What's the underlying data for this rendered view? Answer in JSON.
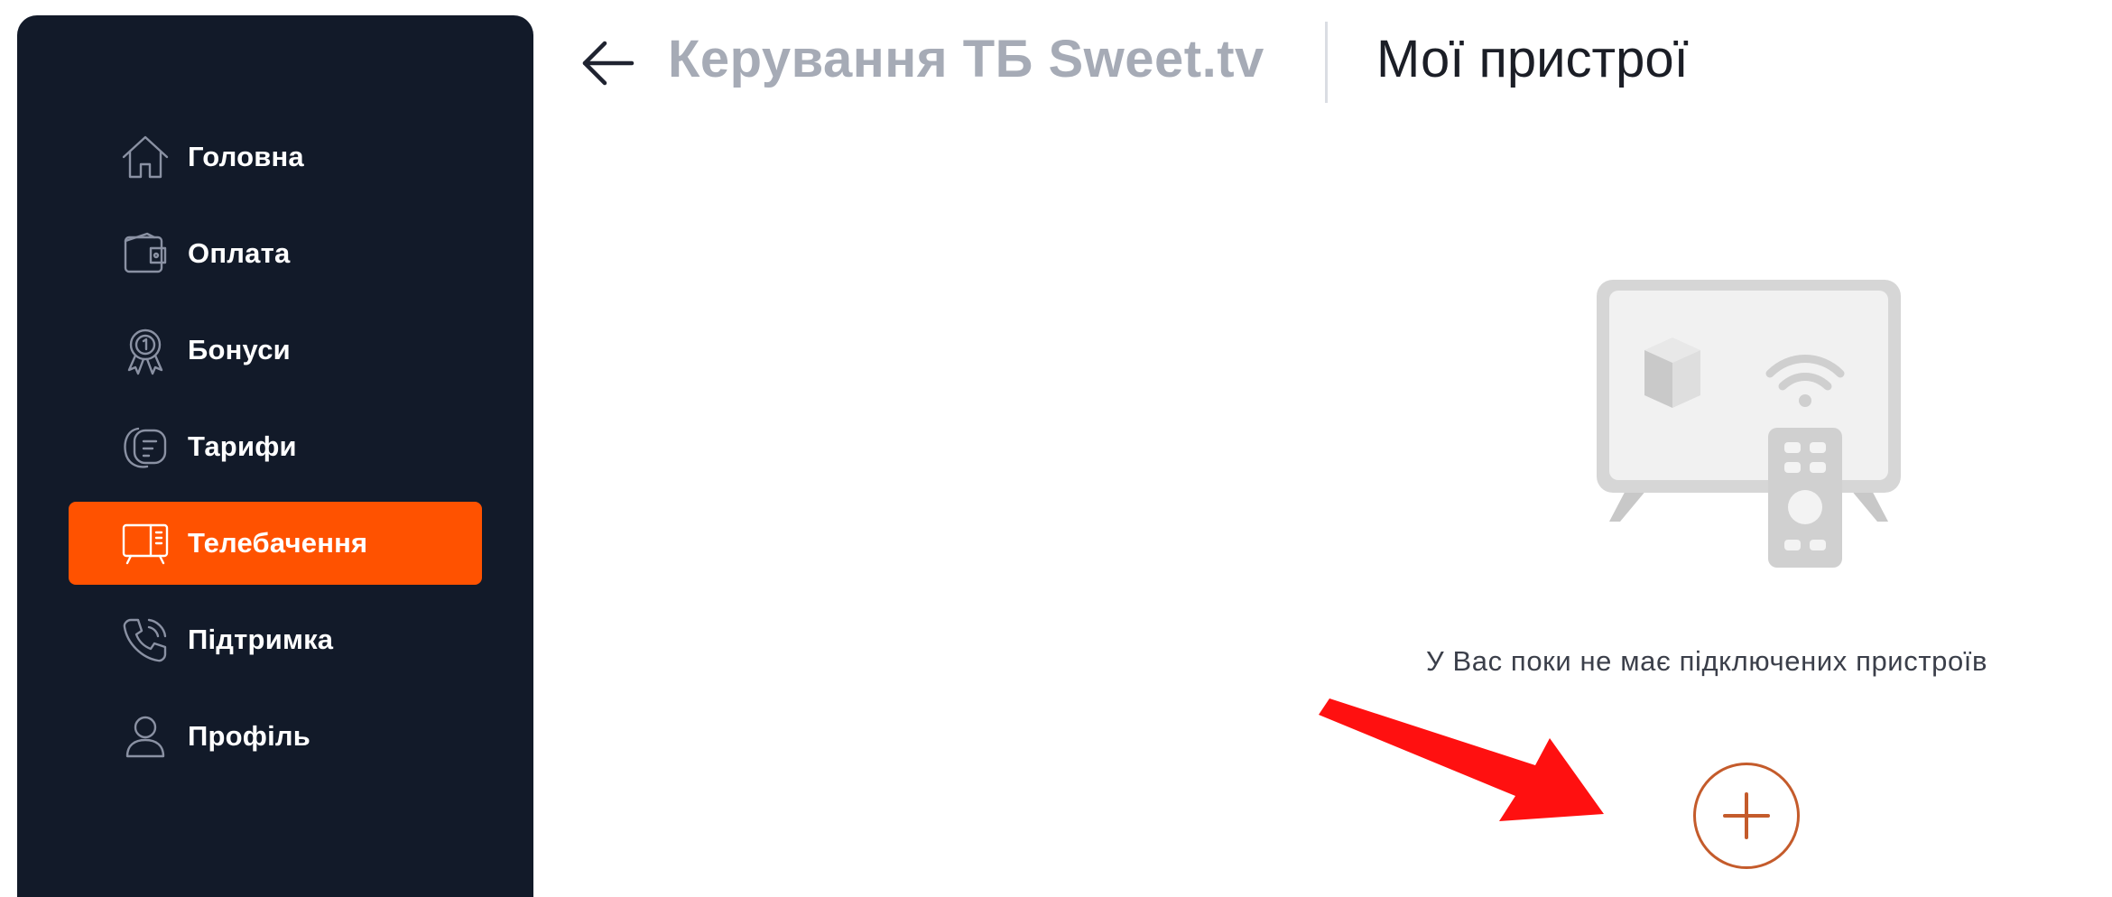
{
  "sidebar": {
    "items": [
      {
        "label": "Головна",
        "icon": "home-icon",
        "active": false
      },
      {
        "label": "Оплата",
        "icon": "wallet-icon",
        "active": false
      },
      {
        "label": "Бонуси",
        "icon": "award-badge-icon",
        "active": false
      },
      {
        "label": "Тарифи",
        "icon": "tariff-icon",
        "active": false
      },
      {
        "label": "Телебачення",
        "icon": "tv-icon",
        "active": true
      },
      {
        "label": "Підтримка",
        "icon": "phone-icon",
        "active": false
      },
      {
        "label": "Профіль",
        "icon": "user-icon",
        "active": false
      }
    ]
  },
  "header": {
    "back_icon": "arrow-left-icon",
    "breadcrumb": "Керування ТБ Sweet.tv",
    "title": "Мої пристрої"
  },
  "empty_state": {
    "illustration": "tv-devices-illustration",
    "message": "У Вас поки не має підключених пристроїв",
    "add_icon": "plus-icon"
  },
  "annotation": {
    "arrow_icon": "red-arrow-pointer"
  },
  "colors": {
    "sidebar_bg": "#121a29",
    "active_item": "#ff5200",
    "add_button": "#c45b2b",
    "annotation_arrow": "#ff1010",
    "breadcrumb": "#a6abb6"
  }
}
